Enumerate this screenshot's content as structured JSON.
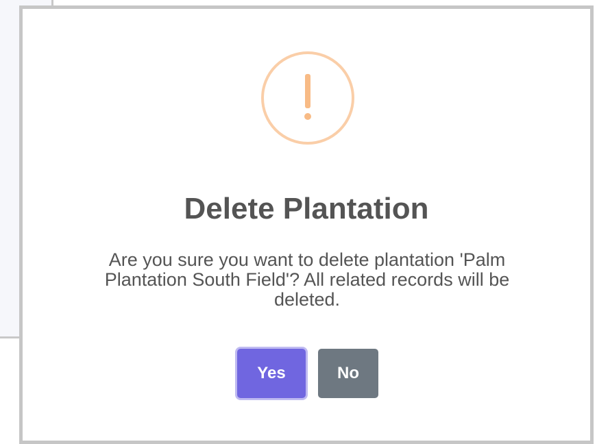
{
  "dialog": {
    "icon": "warning-exclamation-icon",
    "icon_color": "#f8bb86",
    "title": "Delete Plantation",
    "message": "Are you sure you want to delete plantation 'Palm Plantation South Field'? All related records will be deleted.",
    "confirm_label": "Yes",
    "cancel_label": "No"
  },
  "colors": {
    "confirm_button": "#7066e0",
    "cancel_button": "#6e7881",
    "text": "#545454"
  }
}
